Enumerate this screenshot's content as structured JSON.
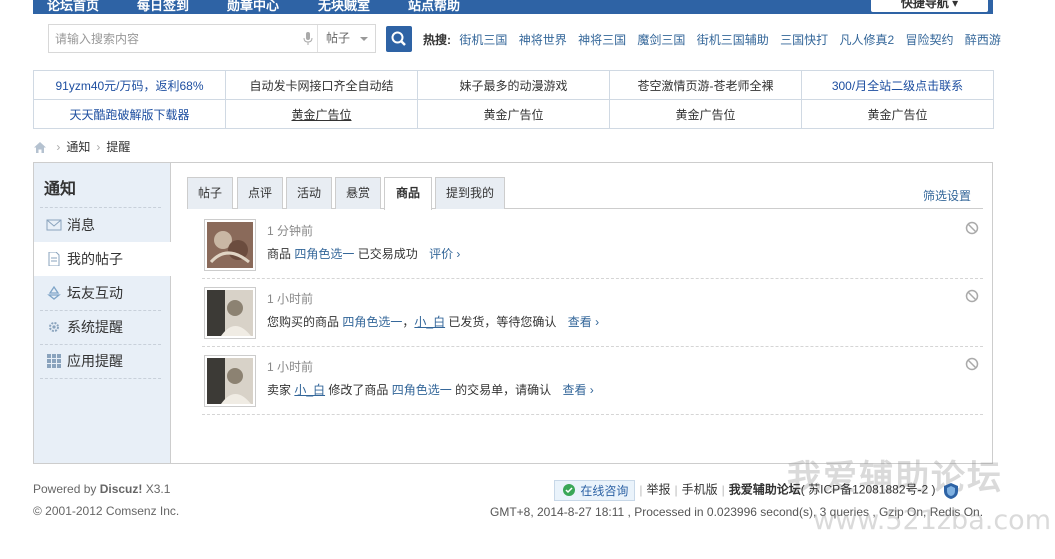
{
  "topnav": {
    "items": [
      "论坛首页",
      "每日签到",
      "勋章中心",
      "无块贼室",
      "站点帮助"
    ],
    "quick_nav": "快捷导航"
  },
  "search": {
    "placeholder": "请输入搜索内容",
    "type": "帖子",
    "hot_label": "热搜:",
    "hot_words": [
      "街机三国",
      "神将世界",
      "神将三国",
      "魔剑三国",
      "街机三国辅助",
      "三国快打",
      "凡人修真2",
      "冒险契约",
      "醉西游"
    ]
  },
  "ads": {
    "row1": [
      "91yzm40元/万码，返利68%",
      "自动发卡网接口齐全自动结",
      "妹子最多的动漫游戏",
      "苍空激情页游-苍老师全裸",
      "300/月全站二级点击联系"
    ],
    "row2": [
      "天天酷跑破解版下载器",
      "黄金广告位",
      "黄金广告位",
      "黄金广告位",
      "黄金广告位"
    ]
  },
  "breadcrumb": [
    "通知",
    "提醒"
  ],
  "sidebar": {
    "title": "通知",
    "items": [
      "消息",
      "我的帖子",
      "坛友互动",
      "系统提醒",
      "应用提醒"
    ]
  },
  "tabs": {
    "items": [
      "帖子",
      "点评",
      "活动",
      "悬赏",
      "商品",
      "提到我的"
    ],
    "filter": "筛选设置"
  },
  "notices": [
    {
      "time": "1 分钟前",
      "parts": [
        "商品",
        "四角色选一",
        "已交易成功"
      ],
      "action": "评价 ›"
    },
    {
      "time": "1 小时前",
      "parts": [
        "您购买的商品",
        "四角色选一",
        "，",
        "小_白",
        "已发货，等待您确认"
      ],
      "action": "查看 ›"
    },
    {
      "time": "1 小时前",
      "parts": [
        "卖家",
        "小_白",
        "修改了商品",
        "四角色选一",
        "的交易单，请确认"
      ],
      "action": "查看 ›"
    }
  ],
  "footer": {
    "powered_prefix": "Powered by ",
    "powered_brand": "Discuz!",
    "version": " X3.1",
    "copyright": "© 2001-2012 Comsenz Inc.",
    "consult": "在线咨询",
    "report": "举报",
    "mobile": "手机版",
    "site_name": "我爱辅助论坛",
    "icp": "( 苏ICP备12081882号-2 )",
    "gmt": "GMT+8, 2014-8-27 18:11 , Processed in 0.023996 second(s), 3 queries , Gzip On, Redis On."
  },
  "watermark": {
    "line1": "我爱辅助论坛",
    "line2": "www.521zba.com"
  },
  "colors": {
    "nav": "#2e63a5",
    "link": "#336699",
    "sidebar_bg": "#e8eff7"
  }
}
